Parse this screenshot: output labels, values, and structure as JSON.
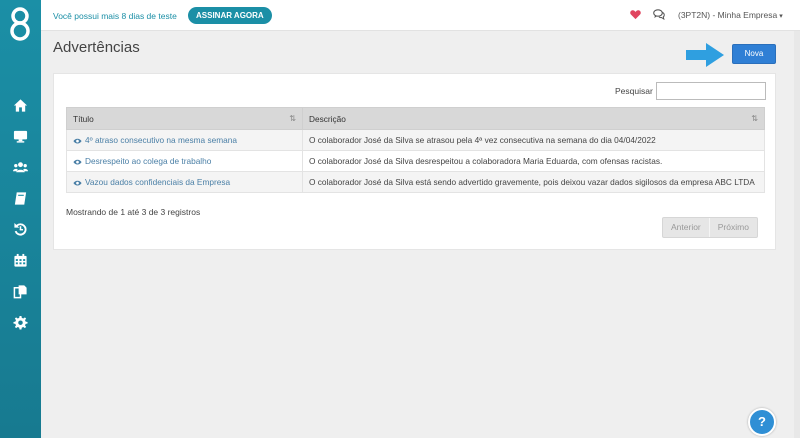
{
  "topbar": {
    "trial_text": "Você possui mais 8 dias de teste",
    "subscribe_label": "ASSINAR AGORA",
    "company_label": "(3PT2N) - Minha Empresa",
    "accent_color": "#1b8fa6",
    "heart_color": "#e0455f"
  },
  "sidebar": {
    "logo": "8-logo",
    "items": [
      {
        "icon": "home-icon"
      },
      {
        "icon": "monitor-icon"
      },
      {
        "icon": "users-icon"
      },
      {
        "icon": "book-icon"
      },
      {
        "icon": "history-icon"
      },
      {
        "icon": "calendar-icon"
      },
      {
        "icon": "documents-icon"
      },
      {
        "icon": "gear-icon"
      }
    ]
  },
  "page": {
    "title": "Advertências",
    "new_button": "Nova",
    "search_label": "Pesquisar",
    "search_value": ""
  },
  "table": {
    "headers": [
      "Título",
      "Descrição"
    ],
    "rows": [
      {
        "title": "4º atraso consecutivo na mesma semana",
        "description": "O colaborador José da Silva se atrasou pela 4ª vez consecutiva na semana do dia 04/04/2022"
      },
      {
        "title": "Desrespeito ao colega de trabalho",
        "description": "O colaborador José da Silva desrespeitou a colaboradora Maria Eduarda, com ofensas racistas."
      },
      {
        "title": "Vazou dados confidenciais da Empresa",
        "description": "O colaborador José da Silva está sendo advertido gravemente, pois deixou vazar dados sigilosos da empresa ABC LTDA"
      }
    ],
    "info": "Mostrando de 1 até 3 de 3 registros",
    "prev_label": "Anterior",
    "next_label": "Próximo"
  },
  "help": {
    "label": "?"
  }
}
